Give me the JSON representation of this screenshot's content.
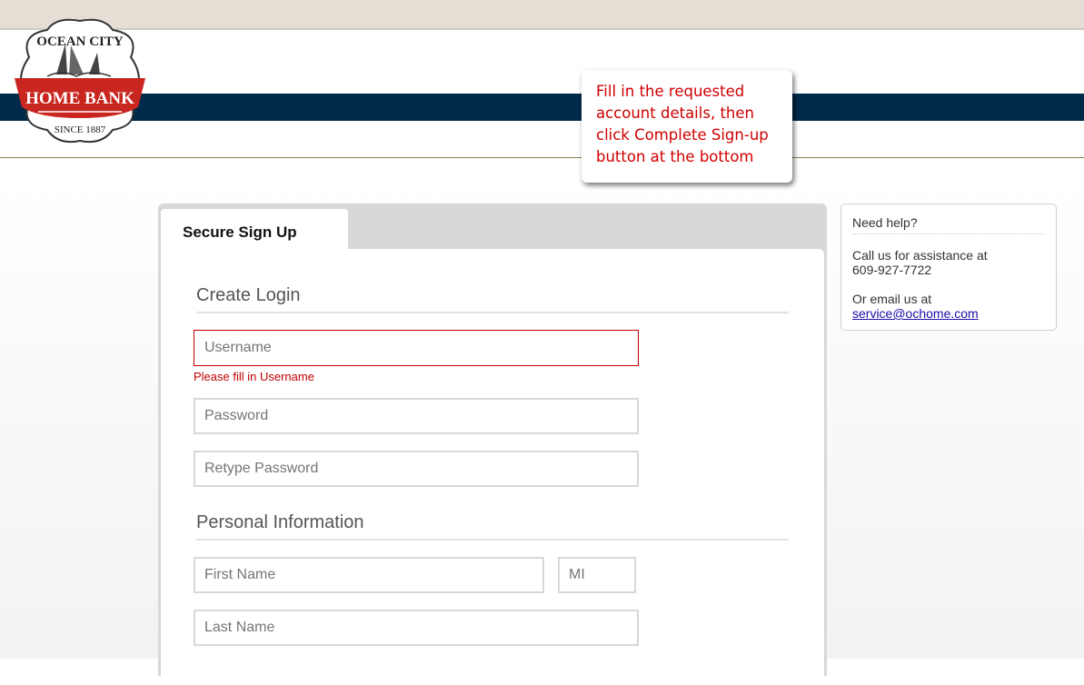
{
  "bank": {
    "logo_top": "OCEAN CITY",
    "logo_name": "HOME BANK",
    "logo_since": "SINCE 1887"
  },
  "tooltip": {
    "line1": "Fill in the requested",
    "line2": "account details, then",
    "line3": "click Complete Sign-up",
    "line4": "button at the bottom"
  },
  "signup": {
    "tab_label": "Secure Sign Up",
    "create_login_title": "Create Login",
    "username_placeholder": "Username",
    "username_error": "Please fill in Username",
    "password_placeholder": "Password",
    "retype_placeholder": "Retype Password",
    "personal_title": "Personal Information",
    "first_name_placeholder": "First Name",
    "mi_placeholder": "MI",
    "last_name_placeholder": "Last Name"
  },
  "help": {
    "title": "Need help?",
    "call_line1": "Call us for assistance at",
    "phone": "609-927-7722",
    "email_line": "Or email us at",
    "email": "service@ochome.com"
  },
  "colors": {
    "navy": "#002a4a",
    "brand_red": "#c8261e",
    "error_red": "#c00000"
  }
}
